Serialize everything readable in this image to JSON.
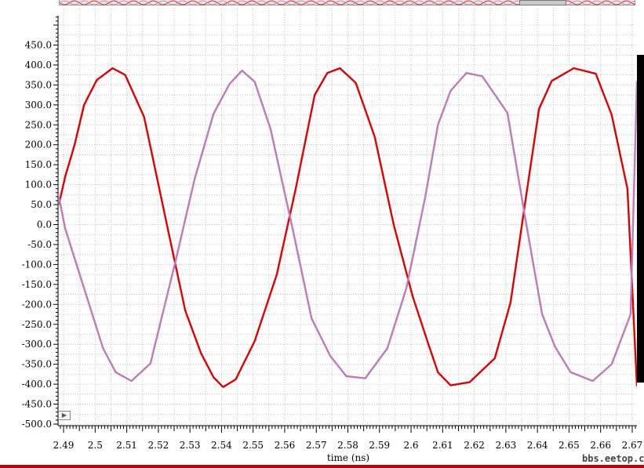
{
  "chart_data": {
    "type": "line",
    "title": "",
    "xlabel": "time (ns)",
    "ylabel": "",
    "xlim": [
      2.4885,
      2.6715
    ],
    "ylim": [
      -500,
      500
    ],
    "x_ticks": [
      2.49,
      2.5,
      2.51,
      2.52,
      2.53,
      2.54,
      2.55,
      2.56,
      2.57,
      2.58,
      2.59,
      2.6,
      2.61,
      2.62,
      2.63,
      2.64,
      2.65,
      2.66,
      2.67
    ],
    "x_tick_labels": [
      "2.49",
      "2.5",
      "2.51",
      "2.52",
      "2.53",
      "2.54",
      "2.55",
      "2.56",
      "2.57",
      "2.58",
      "2.59",
      "2.6",
      "2.61",
      "2.62",
      "2.63",
      "2.64",
      "2.65",
      "2.66",
      "2.67"
    ],
    "y_ticks": [
      450,
      400,
      350,
      300,
      250,
      200,
      150,
      100,
      50,
      0,
      -50,
      -100,
      -150,
      -200,
      -250,
      -300,
      -350,
      -400,
      -450,
      -500
    ],
    "y_tick_labels": [
      "450.0",
      "400.0",
      "350.0",
      "300.0",
      "250.0",
      "200.0",
      "150.0",
      "100.0",
      "50.0",
      "0.0",
      "-50.0",
      "-100.0",
      "-150.0",
      "-200.0",
      "-250.0",
      "-300.0",
      "-350.0",
      "-400.0",
      "-450.0",
      "-500.0"
    ],
    "grid": true,
    "legend": "none",
    "series": [
      {
        "color": "#e00000",
        "x": [
          2.4885,
          2.4905,
          2.4935,
          2.4965,
          2.5005,
          2.5055,
          2.5095,
          2.5155,
          2.5235,
          2.5285,
          2.5335,
          2.5375,
          2.5405,
          2.5445,
          2.5505,
          2.5575,
          2.5635,
          2.5695,
          2.5735,
          2.5775,
          2.5825,
          2.5885,
          2.5945,
          2.6005,
          2.6055,
          2.6085,
          2.6125,
          2.6185,
          2.6265,
          2.6315,
          2.6365,
          2.6405,
          2.6445,
          2.6515,
          2.6585,
          2.6635,
          2.6685,
          2.6715
        ],
        "values": [
          50,
          120,
          200,
          300,
          362,
          392,
          375,
          270,
          -30,
          -215,
          -322,
          -383,
          -407,
          -388,
          -292,
          -125,
          90,
          325,
          380,
          392,
          355,
          220,
          0,
          -180,
          -300,
          -370,
          -403,
          -395,
          -335,
          -195,
          75,
          290,
          360,
          392,
          378,
          275,
          90,
          -405
        ]
      },
      {
        "color": "#c07ab8",
        "x": [
          2.4885,
          2.4905,
          2.4945,
          2.4985,
          2.5025,
          2.5065,
          2.5115,
          2.5175,
          2.5255,
          2.5315,
          2.5375,
          2.5425,
          2.5465,
          2.5505,
          2.5555,
          2.5625,
          2.5685,
          2.5745,
          2.5795,
          2.5855,
          2.5925,
          2.5985,
          2.6045,
          2.6085,
          2.6125,
          2.6175,
          2.6225,
          2.6305,
          2.6365,
          2.6415,
          2.6455,
          2.6505,
          2.6575,
          2.6635,
          2.6695,
          2.6715
        ],
        "values": [
          70,
          -10,
          -110,
          -210,
          -310,
          -370,
          -392,
          -348,
          -90,
          115,
          278,
          352,
          386,
          358,
          240,
          -10,
          -235,
          -330,
          -380,
          -385,
          -310,
          -160,
          70,
          250,
          335,
          380,
          372,
          280,
          0,
          -225,
          -305,
          -370,
          -392,
          -350,
          -225,
          360
        ]
      }
    ]
  },
  "ui": {
    "play_button_symbol": "▶",
    "watermark": "bbs.eetop.cn"
  }
}
